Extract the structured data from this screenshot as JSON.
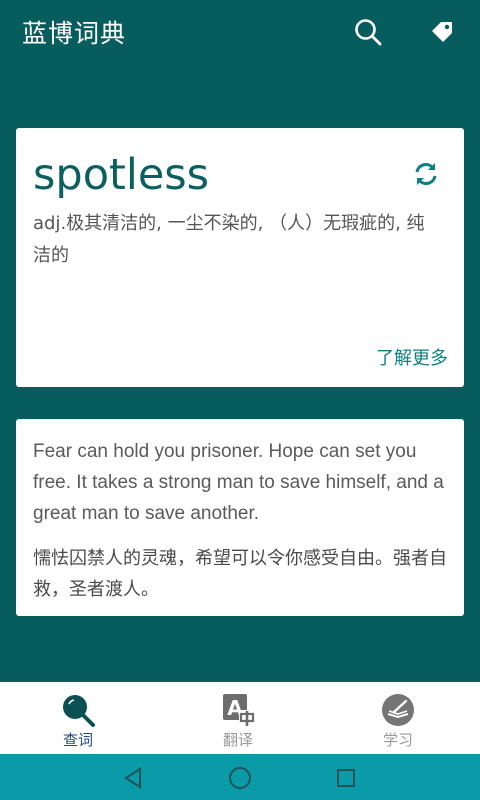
{
  "app": {
    "title": "蓝博词典"
  },
  "header": {
    "icons": [
      "search-icon",
      "tag-icon"
    ]
  },
  "word_card": {
    "word": "spotless",
    "definition": "adj.极其清洁的, 一尘不染的, （人）无瑕疵的, 纯洁的",
    "more_label": "了解更多",
    "refresh_icon": "refresh-icon"
  },
  "quote_card": {
    "english": "Fear can hold you prisoner. Hope can set you free. It takes a strong man to save himself, and a great man to save another.",
    "chinese": "懦怯囚禁人的灵魂，希望可以令你感受自由。强者自救，圣者渡人。"
  },
  "bottom_nav": {
    "items": [
      {
        "label": "查词",
        "icon": "search-icon",
        "active": true
      },
      {
        "label": "翻译",
        "icon": "translate-icon",
        "active": false
      },
      {
        "label": "学习",
        "icon": "study-icon",
        "active": false
      }
    ]
  },
  "system_nav": {
    "icons": [
      "back-icon",
      "home-icon",
      "recent-apps-icon"
    ]
  },
  "colors": {
    "background": "#075c5e",
    "accent": "#0f7f80",
    "active_nav": "#1c4a88",
    "system_bar": "#0a9aa8"
  }
}
